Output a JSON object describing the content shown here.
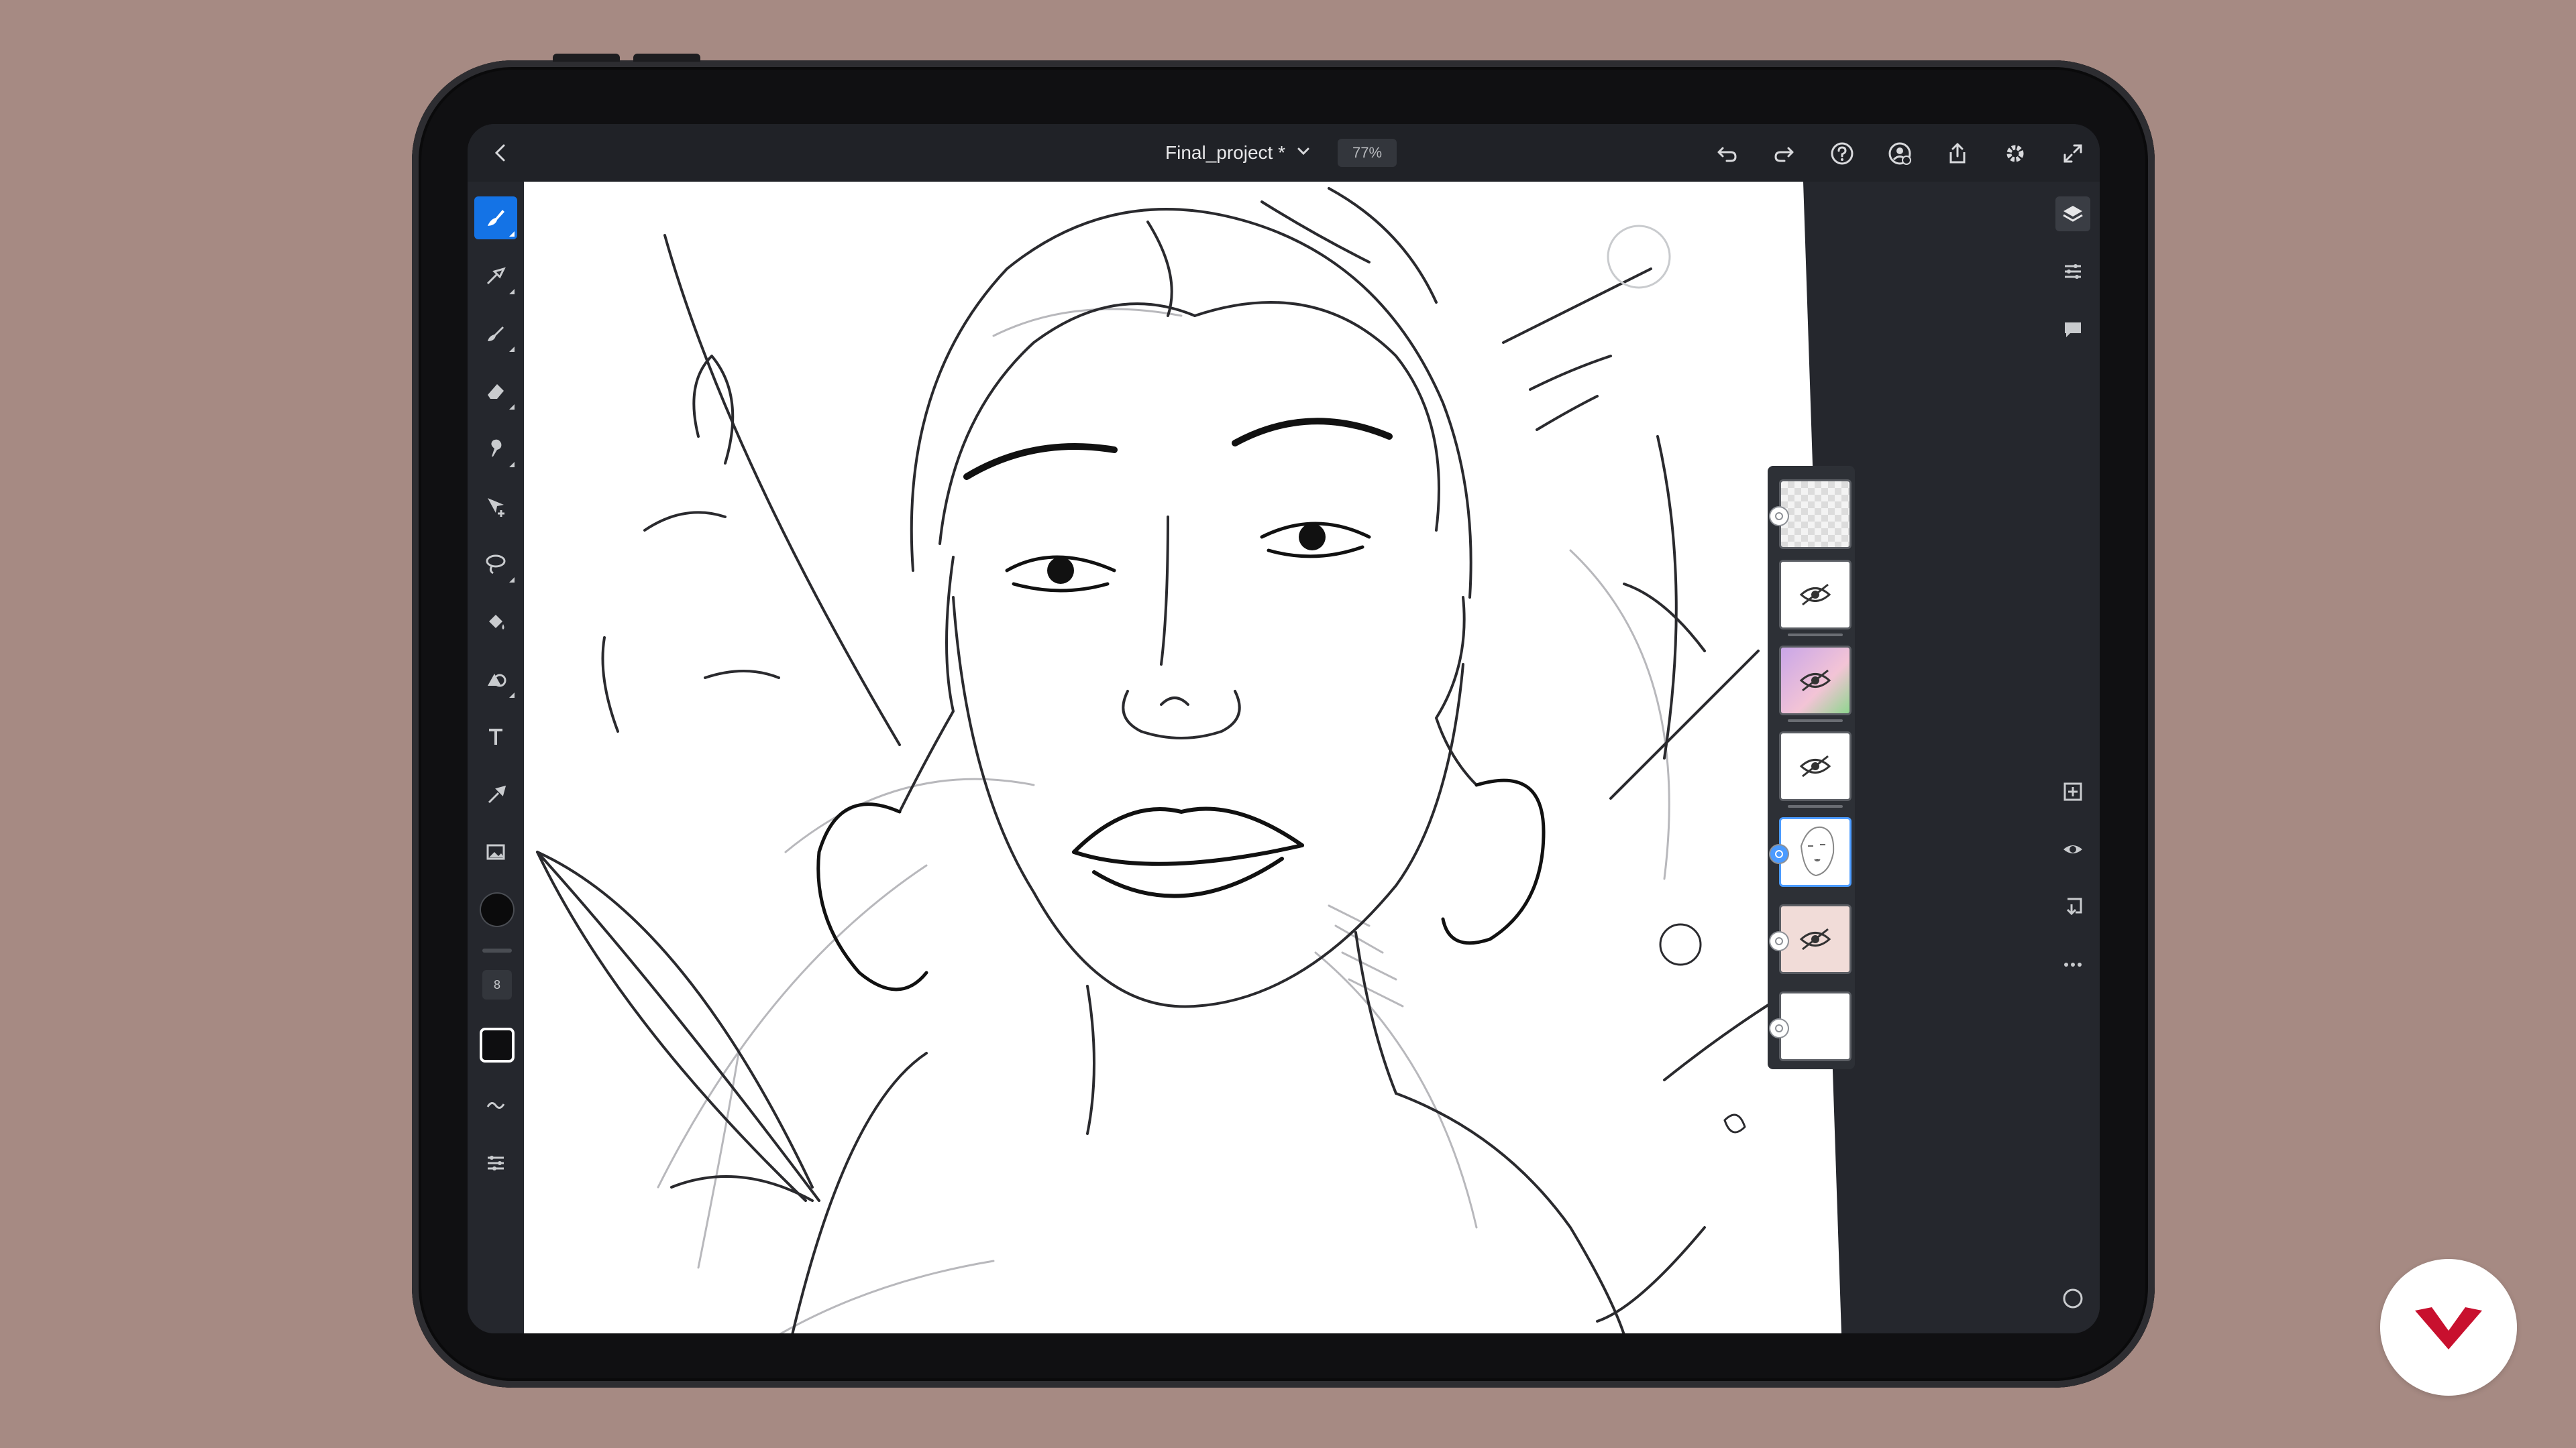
{
  "app": {
    "document_title": "Final_project *",
    "zoom": "77%"
  },
  "top_bar": {
    "icons": [
      "back-chevron-icon",
      "undo-icon",
      "redo-icon",
      "help-icon",
      "invite-user-icon",
      "share-icon",
      "settings-gear-icon",
      "fullscreen-icon"
    ]
  },
  "left_toolbar": {
    "tools": [
      {
        "name": "brush-tool",
        "active": true
      },
      {
        "name": "pixel-brush-tool",
        "active": false
      },
      {
        "name": "live-brush-tool",
        "active": false
      },
      {
        "name": "eraser-tool",
        "active": false
      },
      {
        "name": "smudge-tool",
        "active": false
      },
      {
        "name": "move-tool",
        "active": false
      },
      {
        "name": "lasso-selection-tool",
        "active": false
      },
      {
        "name": "fill-tool",
        "active": false
      },
      {
        "name": "shape-tool",
        "active": false
      },
      {
        "name": "type-tool",
        "active": false
      },
      {
        "name": "eyedropper-tool",
        "active": false
      },
      {
        "name": "place-image-tool",
        "active": false
      }
    ],
    "brush_size": "8",
    "primary_color": "#0b0b0c"
  },
  "right_rail": {
    "icons": [
      "layers-icon",
      "properties-icon",
      "comments-icon",
      "add-layer-icon",
      "visibility-eye-icon",
      "merge-down-icon",
      "more-options-icon",
      "status-circle-icon"
    ]
  },
  "layers": [
    {
      "name": "layer-1",
      "type": "transparent",
      "hidden": false,
      "selected": false
    },
    {
      "name": "layer-2",
      "type": "hidden",
      "hidden": true,
      "selected": false
    },
    {
      "name": "layer-3",
      "type": "color-sketch",
      "hidden": true,
      "selected": false
    },
    {
      "name": "layer-4",
      "type": "hidden",
      "hidden": true,
      "selected": false
    },
    {
      "name": "layer-5",
      "type": "line-sketch",
      "hidden": false,
      "selected": true
    },
    {
      "name": "layer-6",
      "type": "pink-sketch",
      "hidden": true,
      "selected": false
    },
    {
      "name": "layer-7",
      "type": "white-background",
      "hidden": false,
      "selected": false
    }
  ],
  "colors": {
    "accent": "#1473e6",
    "background": "#a68a83",
    "ui_dark": "#25272d",
    "brand_red": "#c8102e"
  }
}
